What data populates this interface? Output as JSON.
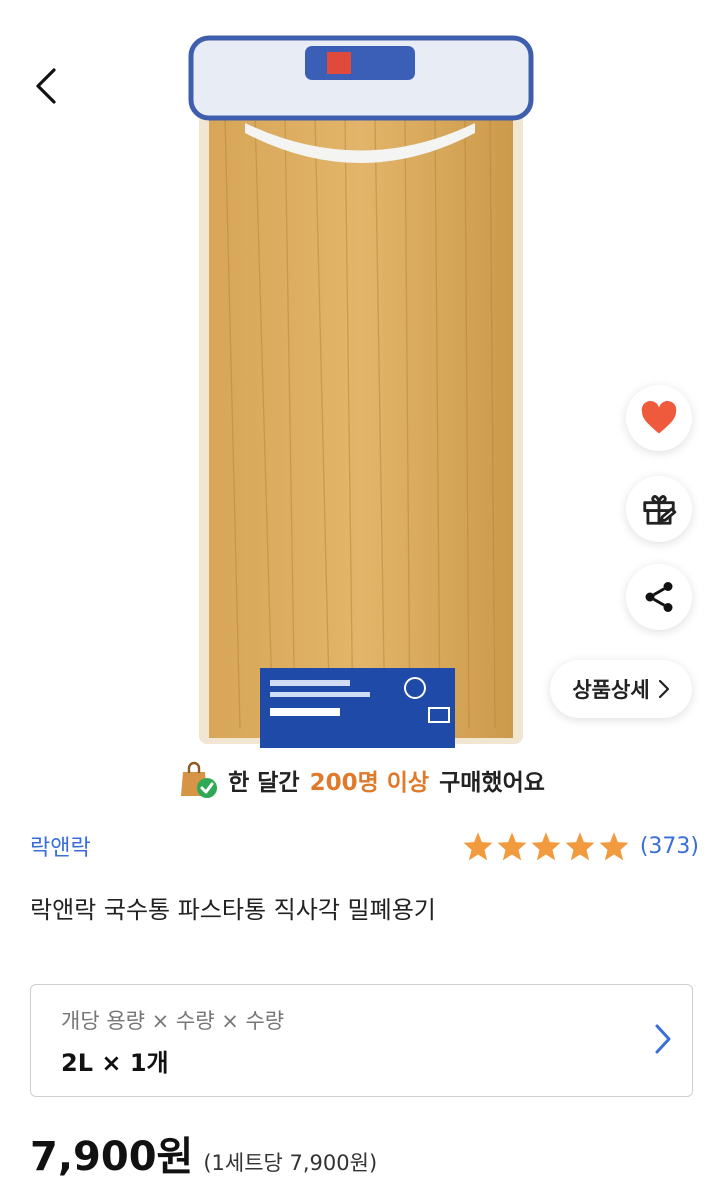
{
  "nav": {
    "back_icon": "chevron-left-icon"
  },
  "fabs": {
    "like_icon": "heart-icon",
    "gift_icon": "gift-icon",
    "share_icon": "share-icon"
  },
  "detail_pill": {
    "label": "상품상세",
    "icon": "chevron-right-icon"
  },
  "purchase_banner": {
    "prefix": "한 달간",
    "highlight": "200명 이상",
    "suffix": "구매했어요",
    "icon": "shopping-bag-check-icon",
    "highlight_color": "#e0792a"
  },
  "brand": "락앤락",
  "rating": {
    "stars": 5,
    "count": "(373)",
    "star_color": "#f29a3e"
  },
  "product": {
    "title": "락앤락 국수통 파스타통 직사각 밀폐용기"
  },
  "option": {
    "label": "개당 용량 × 수량 × 수량",
    "value": "2L × 1개",
    "icon": "chevron-right-icon"
  },
  "price": {
    "main": "7,900원",
    "unit": "(1세트당 7,900원)"
  },
  "colors": {
    "accent": "#3a6ed8",
    "like": "#f05a3c"
  }
}
